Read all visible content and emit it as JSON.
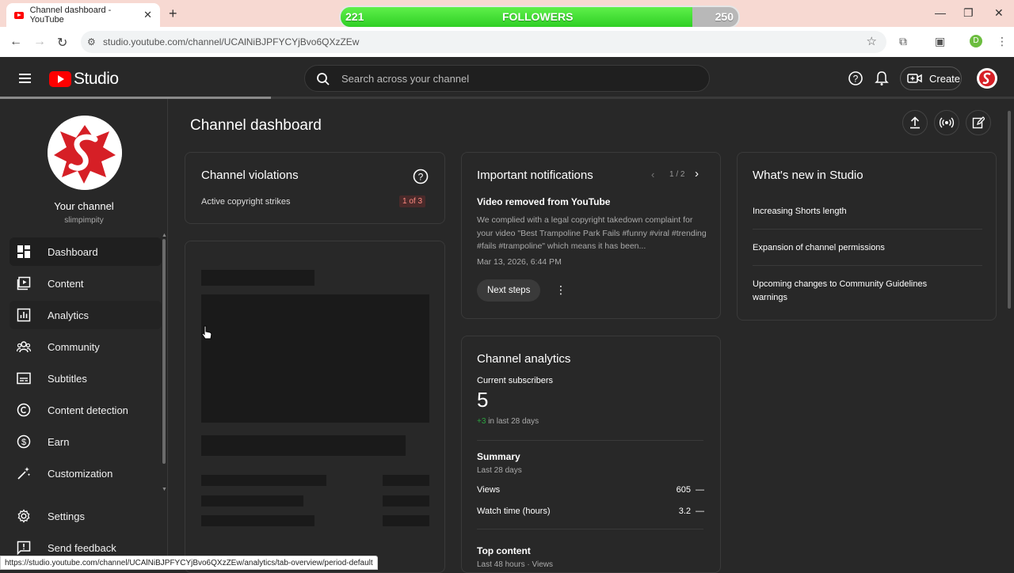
{
  "browser": {
    "tab_title": "Channel dashboard - YouTube",
    "new_tab": "+",
    "url": "studio.youtube.com/channel/UCAlNiBJPFYCYjBvo6QXzZEw",
    "status_url": "https://studio.youtube.com/channel/UCAlNiBJPFYCYjBvo6QXzZEw/analytics/tab-overview/period-default",
    "profile_initial": "D"
  },
  "overlay": {
    "label": "FOLLOWERS",
    "current": "221",
    "goal": "250",
    "progress_fraction": 0.884
  },
  "header": {
    "logo_text": "Studio",
    "search_placeholder": "Search across your channel",
    "create_label": "Create"
  },
  "sidebar": {
    "channel_name": "Your channel",
    "channel_handle": "slimpimpity",
    "items": [
      {
        "label": "Dashboard"
      },
      {
        "label": "Content"
      },
      {
        "label": "Analytics"
      },
      {
        "label": "Community"
      },
      {
        "label": "Subtitles"
      },
      {
        "label": "Content detection"
      },
      {
        "label": "Earn"
      },
      {
        "label": "Customization"
      },
      {
        "label": "Settings"
      },
      {
        "label": "Send feedback"
      }
    ]
  },
  "main": {
    "title": "Channel dashboard",
    "violations": {
      "title": "Channel violations",
      "strikes_label": "Active copyright strikes",
      "strikes_value": "1 of 3"
    },
    "notifications": {
      "title": "Important notifications",
      "pager": "1 / 2",
      "headline": "Video removed from YouTube",
      "body": "We complied with a legal copyright takedown complaint for your video \"Best Trampoline Park Fails #funny #viral #trending #fails #trampoline\" which means it has been...",
      "date": "Mar 13, 2026, 6:44 PM",
      "button": "Next steps"
    },
    "whats_new": {
      "title": "What's new in Studio",
      "items": [
        "Increasing Shorts length",
        "Expansion of channel permissions",
        "Upcoming changes to Community Guidelines warnings"
      ]
    },
    "analytics": {
      "title": "Channel analytics",
      "subs_label": "Current subscribers",
      "subs_value": "5",
      "subs_delta": "+3",
      "subs_delta_suffix": "in last 28 days",
      "summary_title": "Summary",
      "summary_period": "Last 28 days",
      "views_label": "Views",
      "views_value": "605",
      "views_trend": "—",
      "watch_label": "Watch time (hours)",
      "watch_value": "3.2",
      "watch_trend": "—",
      "top_title": "Top content",
      "top_period": "Last 48 hours · Views"
    }
  },
  "colors": {
    "accent_red": "#ff0000",
    "strike_badge": "#ea4335",
    "positive_green": "#2ba640",
    "overlay_green": "#3fe032"
  }
}
